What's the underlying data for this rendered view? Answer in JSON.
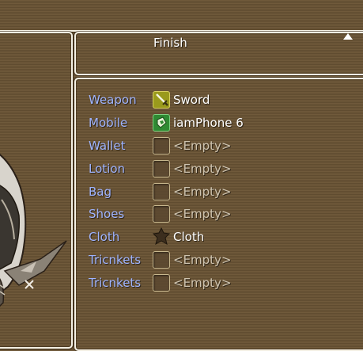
{
  "colors": {
    "background": "#6b5535",
    "window_border": "#f4f0e4",
    "slot_label": "#9fb4ff",
    "item_text": "#ffffff",
    "empty_text": "#cfc4b0"
  },
  "command": {
    "finish_label": "Finish"
  },
  "slots": [
    {
      "label": "Weapon",
      "item": "Sword",
      "icon": "sword-icon",
      "empty": false
    },
    {
      "label": "Mobile",
      "item": "iamPhone 6",
      "icon": "phone-icon",
      "empty": false
    },
    {
      "label": "Wallet",
      "item": "<Empty>",
      "icon": "empty-slot-icon",
      "empty": true
    },
    {
      "label": "Lotion",
      "item": "<Empty>",
      "icon": "empty-slot-icon",
      "empty": true
    },
    {
      "label": "Bag",
      "item": "<Empty>",
      "icon": "empty-slot-icon",
      "empty": true
    },
    {
      "label": "Shoes",
      "item": "<Empty>",
      "icon": "empty-slot-icon",
      "empty": true
    },
    {
      "label": "Cloth",
      "item": "Cloth",
      "icon": "star-icon",
      "empty": false
    },
    {
      "label": "Tricnkets",
      "item": "<Empty>",
      "icon": "empty-slot-icon",
      "empty": true
    },
    {
      "label": "Tricnkets",
      "item": "<Empty>",
      "icon": "empty-slot-icon",
      "empty": true
    }
  ]
}
